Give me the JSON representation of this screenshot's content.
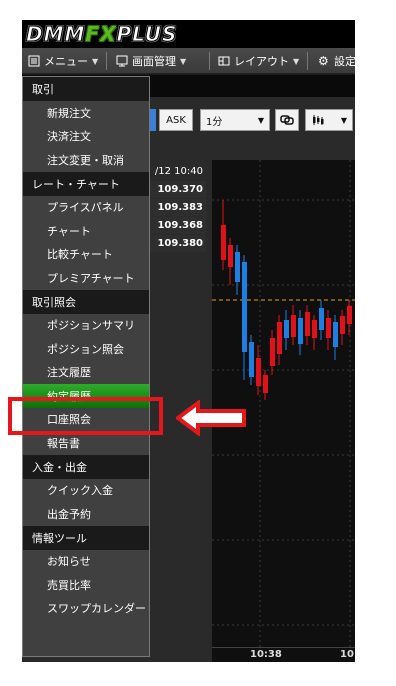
{
  "logo": {
    "part1": "DMM",
    "part2": "FX",
    "part3": "PLUS"
  },
  "toolbar": {
    "menu_label": "メニュー",
    "screen_mgmt_label": "画面管理",
    "layout_label": "レイアウト",
    "settings_label": "設定"
  },
  "controls": {
    "ask_label": "ASK",
    "timeframe_value": "1分",
    "dropdown_glyph": "▼"
  },
  "quotes": {
    "time": "/12 10:40",
    "values": [
      "109.370",
      "109.383",
      "109.368",
      "109.380"
    ]
  },
  "chart_axis": {
    "ticks": [
      "10:38",
      "10:"
    ]
  },
  "colors": {
    "up": "#e0111b",
    "down": "#1e7fe0",
    "selected_start": "#2cae2a",
    "selected_end": "#0b6f09",
    "annotation": "#e4171c"
  },
  "menu": {
    "sections": [
      {
        "title": "取引",
        "items": [
          "新規注文",
          "決済注文",
          "注文変更・取消"
        ]
      },
      {
        "title": "レート・チャート",
        "items": [
          "プライスパネル",
          "チャート",
          "比較チャート",
          "プレミアチャート"
        ]
      },
      {
        "title": "取引照会",
        "items": [
          "ポジションサマリ",
          "ポジション照会",
          "注文履歴",
          "約定履歴",
          "口座照会",
          "報告書"
        ]
      },
      {
        "title": "入金・出金",
        "items": [
          "クイック入金",
          "出金予約"
        ]
      },
      {
        "title": "情報ツール",
        "items": [
          "お知らせ",
          "売買比率",
          "スワップカレンダー"
        ]
      }
    ],
    "selected_item": "約定履歴"
  }
}
